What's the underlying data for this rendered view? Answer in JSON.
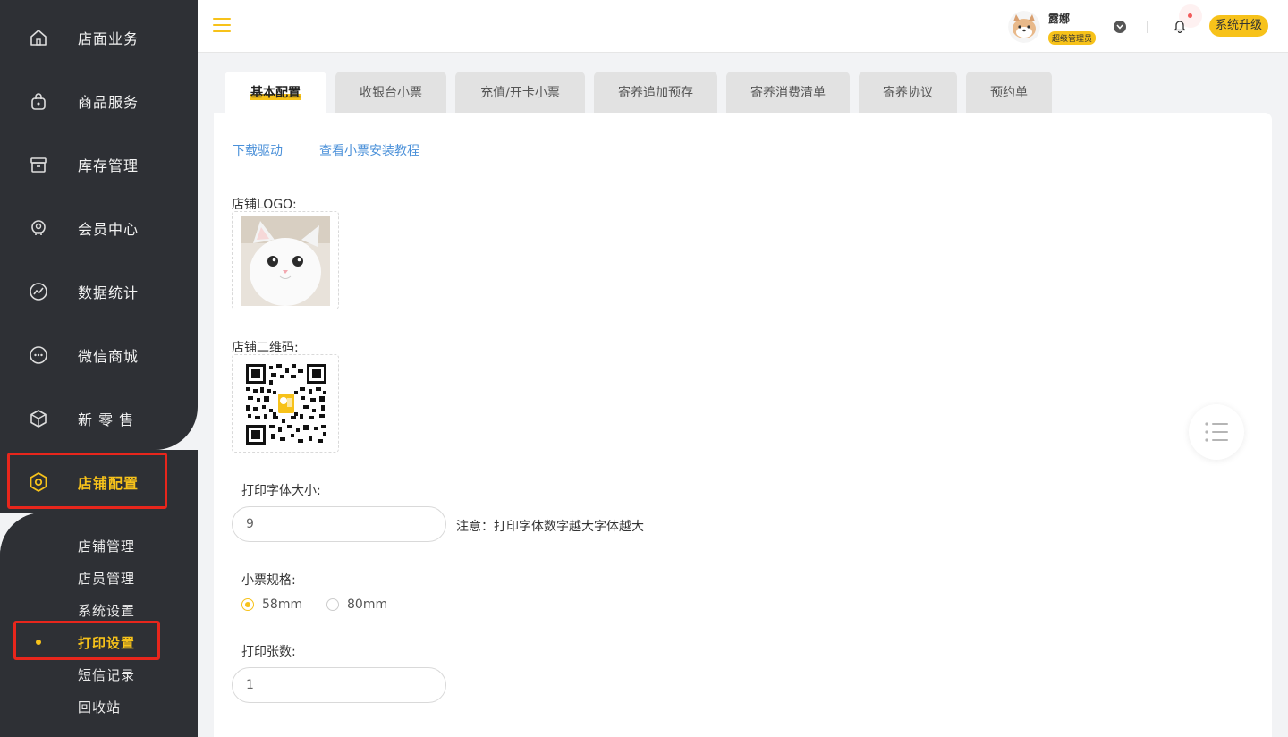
{
  "sidebar": {
    "items": [
      {
        "label": "店面业务",
        "icon": "home-icon"
      },
      {
        "label": "商品服务",
        "icon": "shopping-bag-icon"
      },
      {
        "label": "库存管理",
        "icon": "archive-icon"
      },
      {
        "label": "会员中心",
        "icon": "member-icon"
      },
      {
        "label": "数据统计",
        "icon": "chart-icon"
      },
      {
        "label": "微信商城",
        "icon": "chat-icon"
      },
      {
        "label": "新 零 售",
        "icon": "cube-icon"
      },
      {
        "label": "店铺配置",
        "icon": "settings-hex-icon"
      }
    ],
    "sub_items": [
      "店铺管理",
      "店员管理",
      "系统设置",
      "打印设置",
      "短信记录",
      "回收站"
    ],
    "active_item": "店铺配置",
    "active_sub_item": "打印设置"
  },
  "header": {
    "username": "露娜",
    "role": "超级管理员",
    "upgrade_label": "系统升级"
  },
  "tabs": [
    "基本配置",
    "收银台小票",
    "充值/开卡小票",
    "寄养追加预存",
    "寄养消费清单",
    "寄养协议",
    "预约单"
  ],
  "active_tab": "基本配置",
  "main": {
    "download_driver": "下载驱动",
    "tutorial_link": "查看小票安装教程",
    "logo_label": "店铺LOGO:",
    "qrcode_label": "店铺二维码:",
    "font_size_label": "打印字体大小:",
    "font_size_value": "9",
    "font_size_note": "注意：打印字体数字越大字体越大",
    "spec_label": "小票规格:",
    "spec_options": [
      "58mm",
      "80mm"
    ],
    "spec_selected": "58mm",
    "copies_label": "打印张数:",
    "copies_value": "1"
  },
  "colors": {
    "accent": "#f7c21a",
    "sidebar_bg": "#2e3035",
    "link": "#4a90d9",
    "highlight_box": "#e8261c"
  }
}
